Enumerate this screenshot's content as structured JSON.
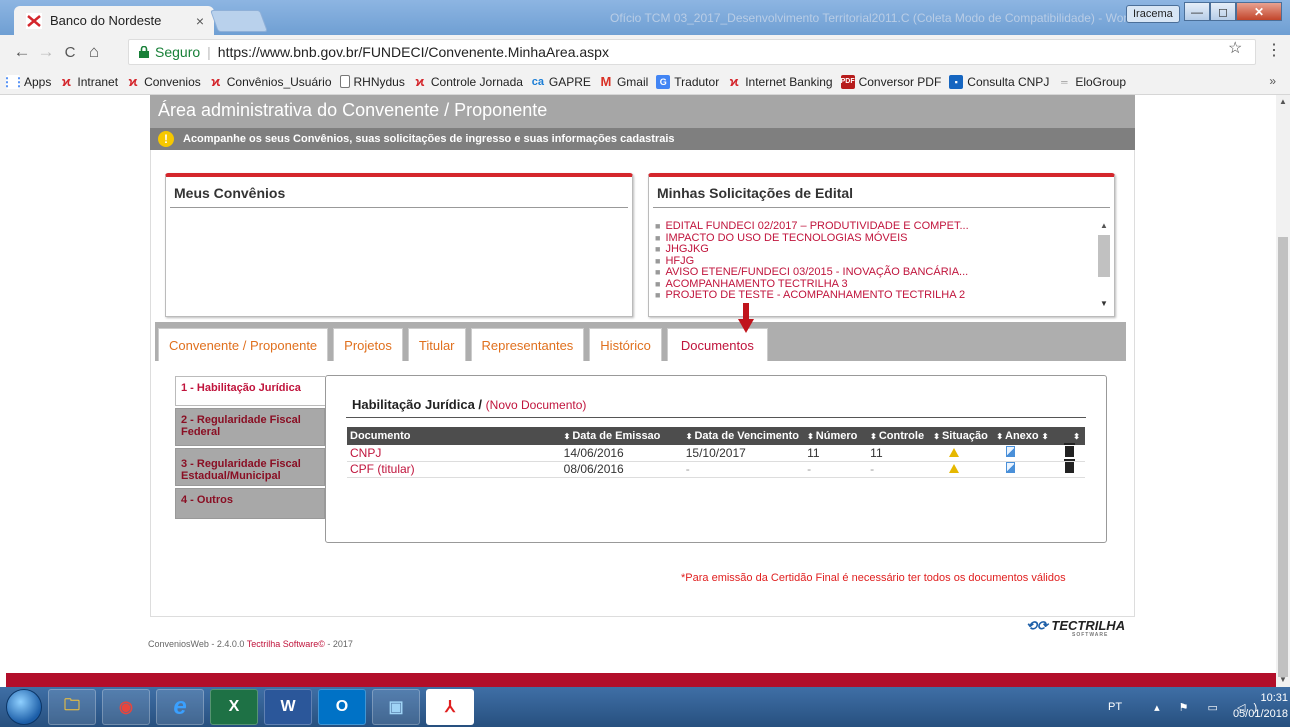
{
  "browser": {
    "tab_title": "Banco do Nordeste",
    "tab_close": "×",
    "window_title": "Ofício TCM 03_2017_Desenvolvimento Territorial2011.C (Coleta Modo de Compatibilidade) - Word",
    "user_badge": "Iracema",
    "win_minimize": "—",
    "win_maximize": "◻",
    "win_close": "✕",
    "back": "←",
    "forward": "→",
    "reload": "C",
    "home": "⌂",
    "secure_label": "Seguro",
    "url_separator": "|",
    "url": "https://www.bnb.gov.br/FUNDECI/Convenente.MinhaArea.aspx",
    "star": "☆",
    "menu": "⋮"
  },
  "bookmarks": {
    "items": [
      {
        "label": "Apps",
        "icon": "apps-grid-icon",
        "color": "#4285f4"
      },
      {
        "label": "Intranet",
        "icon": "bnb-logo-icon",
        "color": "#d4262c"
      },
      {
        "label": "Convenios",
        "icon": "bnb-logo-icon",
        "color": "#d4262c"
      },
      {
        "label": "Convênios_Usuário",
        "icon": "bnb-logo-icon",
        "color": "#d4262c"
      },
      {
        "label": "RHNydus",
        "icon": "page-icon",
        "color": "#777777"
      },
      {
        "label": "Controle Jornada",
        "icon": "bnb-logo-icon",
        "color": "#d4262c"
      },
      {
        "label": "GAPRE",
        "icon": "ca-icon",
        "color": "#1c7ed6"
      },
      {
        "label": "Gmail",
        "icon": "gmail-icon",
        "color": "#d93025"
      },
      {
        "label": "Tradutor",
        "icon": "translate-icon",
        "color": "#4285f4"
      },
      {
        "label": "Internet Banking",
        "icon": "bnb-logo-icon",
        "color": "#d4262c"
      },
      {
        "label": "Conversor PDF",
        "icon": "pdf-icon",
        "color": "#b71c1c"
      },
      {
        "label": "Consulta CNPJ",
        "icon": "cnpj-icon",
        "color": "#1565c0"
      },
      {
        "label": "EloGroup",
        "icon": "elogroup-icon",
        "color": "#999999"
      }
    ],
    "more": "»"
  },
  "page": {
    "header_title": "Área administrativa do Convenente / Proponente",
    "info_icon": "!",
    "info_text": "Acompanhe os seus Convênios, suas solicitações de ingresso e suas informações cadastrais",
    "meus_convenios_title": "Meus Convênios",
    "solicitacoes_title": "Minhas Solicitações de Edital",
    "solicitacoes": [
      "EDITAL FUNDECI 02/2017 – PRODUTIVIDADE E COMPET...",
      "IMPACTO DO USO DE TECNOLOGIAS MÓVEIS",
      "JHGJKG",
      "HFJG",
      "AVISO ETENE/FUNDECI 03/2015 - INOVAÇÃO BANCÁRIA...",
      "ACOMPANHAMENTO TECTRILHA 3",
      "PROJETO DE TESTE - ACOMPANHAMENTO TECTRILHA 2"
    ],
    "tabs": [
      {
        "label": "Convenente / Proponente",
        "active": false
      },
      {
        "label": "Projetos",
        "active": false
      },
      {
        "label": "Titular",
        "active": false
      },
      {
        "label": "Representantes",
        "active": false
      },
      {
        "label": "Histórico",
        "active": false
      },
      {
        "label": "Documentos",
        "active": true
      }
    ],
    "side_tabs": [
      {
        "label": "1 - Habilitação Jurídica",
        "active": true
      },
      {
        "label": "2 - Regularidade Fiscal Federal",
        "active": false
      },
      {
        "label": "3 - Regularidade Fiscal Estadual/Municipal",
        "active": false
      },
      {
        "label": "4 - Outros",
        "active": false
      }
    ],
    "doc_section_title": "Habilitação Jurídica /",
    "new_document_link": "(Novo Documento)",
    "table_headers": [
      "Documento",
      "Data de Emissao",
      "Data de Vencimento",
      "Número",
      "Controle",
      "Situação",
      "Anexo",
      ""
    ],
    "sort_glyph": "⬍",
    "rows": [
      {
        "documento": "CNPJ",
        "emissao": "14/06/2016",
        "vencimento": "15/10/2017",
        "numero": "11",
        "controle": "11"
      },
      {
        "documento": "CPF (titular)",
        "emissao": "08/06/2016",
        "vencimento": "-",
        "numero": "-",
        "controle": "-"
      }
    ],
    "note": "*Para emissão da Certidão Final é necessário ter todos os documentos válidos",
    "logo_text": "TECTRILHA",
    "logo_subtext": "SOFTWARE",
    "footer_prefix": "ConveniosWeb - 2.4.0.0",
    "footer_brand": "Tectrilha Software©",
    "footer_suffix": "- 2017"
  },
  "taskbar": {
    "apps": [
      "file-explorer-icon",
      "chrome-icon",
      "internet-explorer-icon",
      "excel-icon",
      "word-icon",
      "outlook-icon",
      "remote-app-icon",
      "acrobat-icon"
    ],
    "app_glyphs": [
      "🗀",
      "◉",
      "e",
      "X",
      "W",
      "O",
      "▣",
      "⅄"
    ],
    "lang": "PT",
    "time": "10:31",
    "date": "05/01/2018"
  },
  "colors": {
    "brand_red": "#d4262c",
    "link_red": "#c0143c",
    "tab_orange": "#e0701e",
    "header_gray": "#a6a6a6",
    "info_gray": "#7f7f7f",
    "arrow_red": "#c0141c"
  }
}
